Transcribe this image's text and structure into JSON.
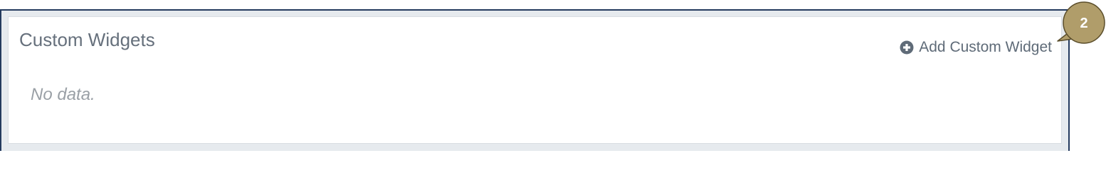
{
  "panel": {
    "title": "Custom Widgets",
    "add_action_label": "Add Custom Widget",
    "add_action_icon": "plus-circle-icon",
    "empty_message": "No data."
  },
  "callout": {
    "number": "2",
    "color": "#b09d6a",
    "border_color": "#5a4d2a"
  },
  "colors": {
    "frame_border": "#243a5e",
    "frame_bg": "#e6eaee",
    "title_text": "#66707c",
    "link_text": "#5f6b78",
    "empty_text": "#9aa0a6"
  }
}
